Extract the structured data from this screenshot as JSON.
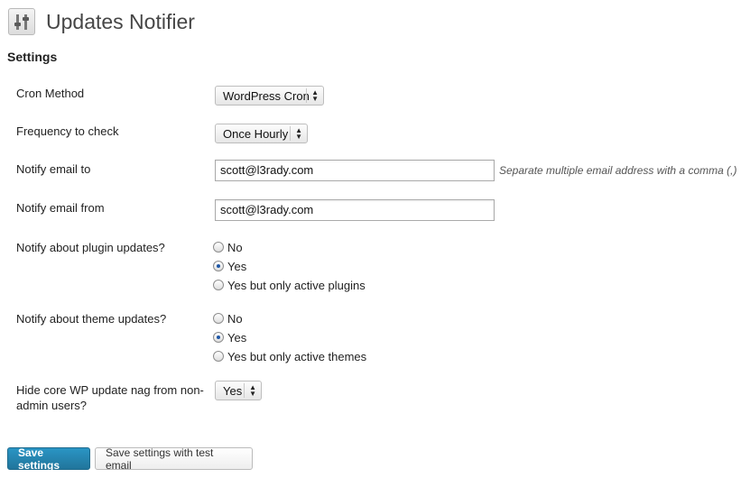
{
  "page": {
    "title": "Updates Notifier",
    "section_title": "Settings",
    "icon": "sliders-icon"
  },
  "fields": {
    "cron_method": {
      "label": "Cron Method",
      "value": "WordPress Cron"
    },
    "frequency": {
      "label": "Frequency to check",
      "value": "Once Hourly"
    },
    "email_to": {
      "label": "Notify email to",
      "value": "scott@l3rady.com",
      "hint": "Separate multiple email address with a comma (,)"
    },
    "email_from": {
      "label": "Notify email from",
      "value": "scott@l3rady.com"
    },
    "plugin_updates": {
      "label": "Notify about plugin updates?",
      "options": [
        "No",
        "Yes",
        "Yes but only active plugins"
      ],
      "selected": "Yes"
    },
    "theme_updates": {
      "label": "Notify about theme updates?",
      "options": [
        "No",
        "Yes",
        "Yes but only active themes"
      ],
      "selected": "Yes"
    },
    "hide_nag": {
      "label_line1": "Hide core WP update nag from non-",
      "label_line2": "admin users?",
      "value": "Yes"
    }
  },
  "buttons": {
    "save": "Save settings",
    "save_test": "Save settings with test email"
  },
  "colors": {
    "primary_button": "#21759b",
    "radio_dot": "#1f57a6"
  }
}
